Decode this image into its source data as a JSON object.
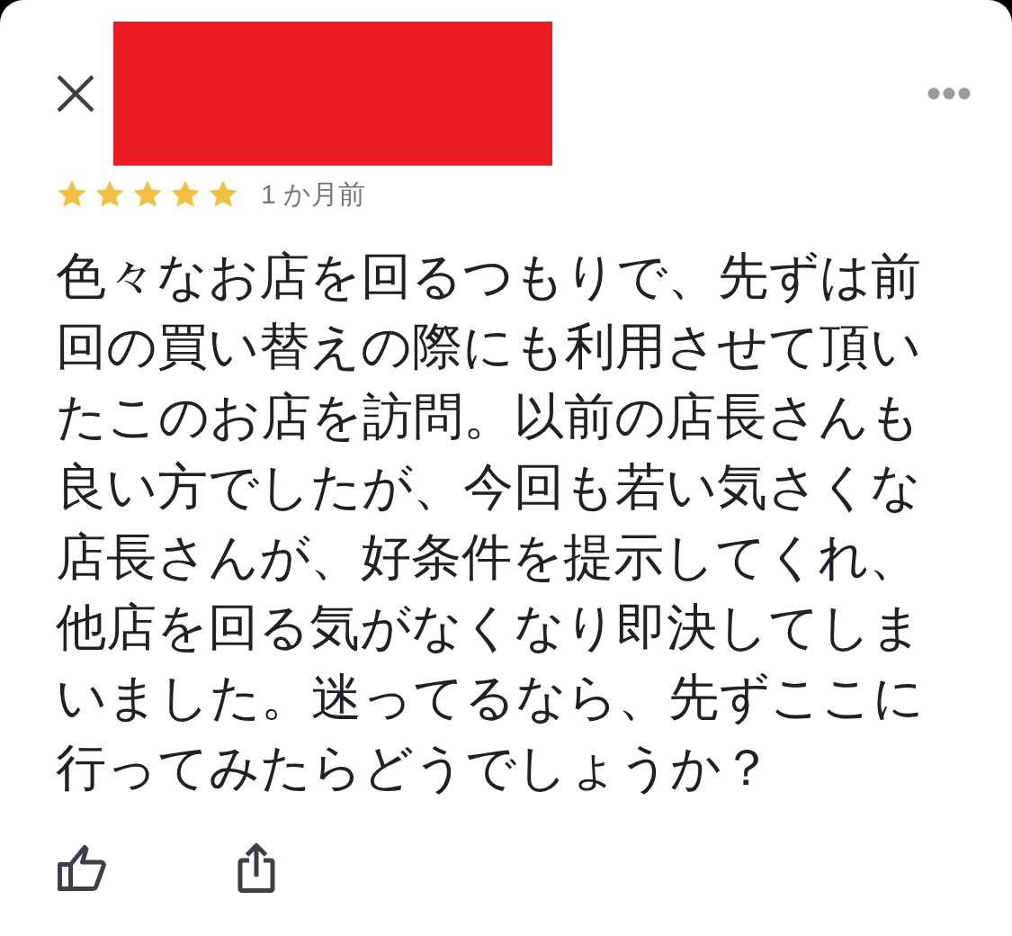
{
  "review": {
    "stars": 5,
    "time": "1 か月前",
    "text": "色々なお店を回るつもりで、先ずは前回の買い替えの際にも利用させて頂いたこのお店を訪問。以前の店長さんも良い方でしたが、今回も若い気さくな店長さんが、好条件を提示してくれ、他店を回る気がなくなり即決してしまいました。迷ってるなら、先ずここに行ってみたらどうでしょうか？"
  }
}
